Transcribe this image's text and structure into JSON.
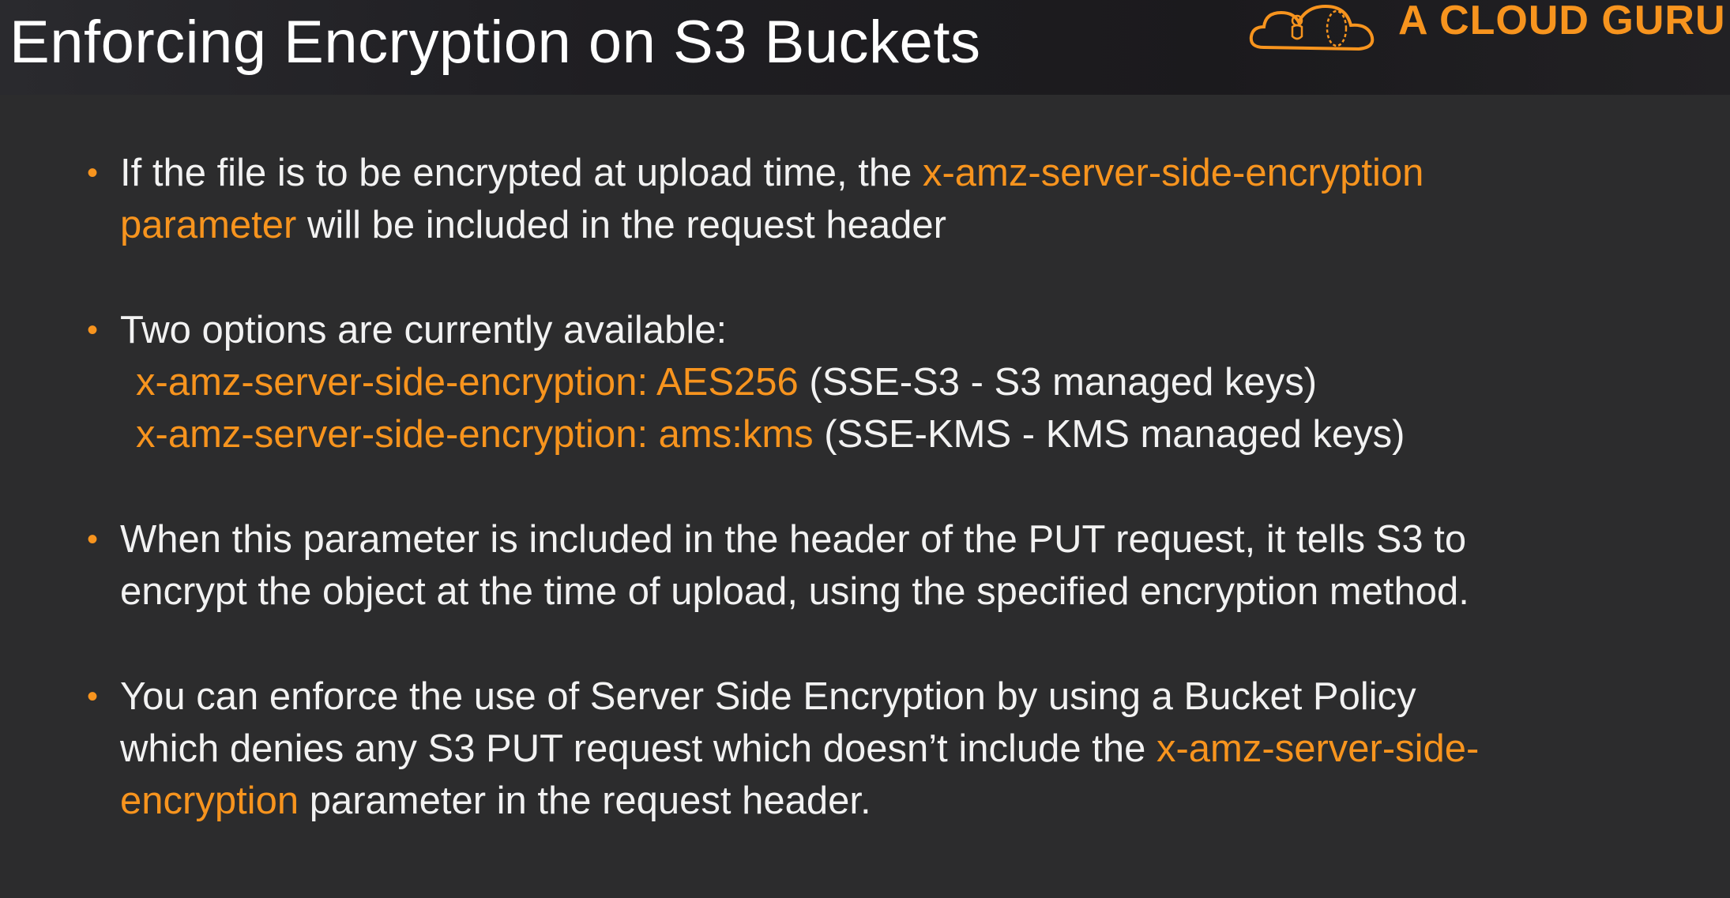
{
  "slide": {
    "title": "Enforcing Encryption on S3 Buckets",
    "logo_text": "A CLOUD GURU",
    "logo_icon": "cloud-guru-icon",
    "colors": {
      "background": "#2c2c2d",
      "text": "#f2f2f2",
      "accent": "#f7941e"
    }
  },
  "bullets": {
    "b1": {
      "l1_text": "If the file is to be encrypted at upload time, the ",
      "l1_hl": "x-amz-server-side-encryption",
      "l2_hl": "parameter",
      "l2_text": " will be included in the request header"
    },
    "b2": {
      "l1_text": "Two options are currently available:",
      "opt1_hl": "x-amz-server-side-encryption: AES256",
      "opt1_text": " (SSE-S3 - S3 managed keys)",
      "opt2_hl": "x-amz-server-side-encryption: ams:kms",
      "opt2_text": " (SSE-KMS - KMS managed keys)"
    },
    "b3": {
      "l1_text": "When this parameter is included in the header of the PUT request, it tells S3 to",
      "l2_text": "encrypt the object at the time of upload,  using the specified encryption method."
    },
    "b4": {
      "l1_text": "You can enforce the use of Server Side Encryption by using a Bucket Policy",
      "l2_text": "which denies any S3 PUT request which doesn’t include the ",
      "l2_hl": "x-amz-server-side-",
      "l3_hl": "encryption",
      "l3_text": " parameter in the request header."
    }
  }
}
